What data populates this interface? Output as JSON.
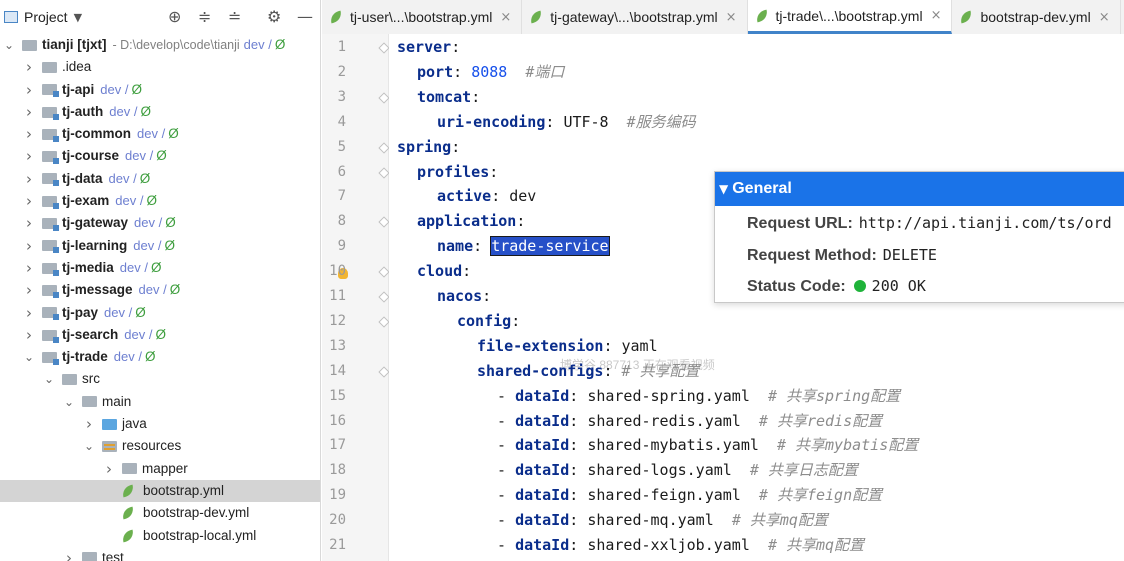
{
  "project": {
    "title": "Project",
    "root": {
      "name": "tianji [tjxt]",
      "path": "- D:\\develop\\code\\tianji",
      "vcs": "dev /",
      "status": "Ø"
    },
    "items": [
      {
        "label": ".idea",
        "type": "folder",
        "level": 1,
        "expanded": false
      },
      {
        "label": "tj-api",
        "vcs": "dev /",
        "status": "Ø",
        "type": "module",
        "level": 1,
        "expanded": false
      },
      {
        "label": "tj-auth",
        "vcs": "dev /",
        "status": "Ø",
        "type": "module",
        "level": 1,
        "expanded": false
      },
      {
        "label": "tj-common",
        "vcs": "dev /",
        "status": "Ø",
        "type": "module",
        "level": 1,
        "expanded": false
      },
      {
        "label": "tj-course",
        "vcs": "dev /",
        "status": "Ø",
        "type": "module",
        "level": 1,
        "expanded": false
      },
      {
        "label": "tj-data",
        "vcs": "dev /",
        "status": "Ø",
        "type": "module",
        "level": 1,
        "expanded": false
      },
      {
        "label": "tj-exam",
        "vcs": "dev /",
        "status": "Ø",
        "type": "module",
        "level": 1,
        "expanded": false
      },
      {
        "label": "tj-gateway",
        "vcs": "dev /",
        "status": "Ø",
        "type": "module",
        "level": 1,
        "expanded": false
      },
      {
        "label": "tj-learning",
        "vcs": "dev /",
        "status": "Ø",
        "type": "module",
        "level": 1,
        "expanded": false
      },
      {
        "label": "tj-media",
        "vcs": "dev /",
        "status": "Ø",
        "type": "module",
        "level": 1,
        "expanded": false
      },
      {
        "label": "tj-message",
        "vcs": "dev /",
        "status": "Ø",
        "type": "module",
        "level": 1,
        "expanded": false
      },
      {
        "label": "tj-pay",
        "vcs": "dev /",
        "status": "Ø",
        "type": "module",
        "level": 1,
        "expanded": false
      },
      {
        "label": "tj-search",
        "vcs": "dev /",
        "status": "Ø",
        "type": "module",
        "level": 1,
        "expanded": false
      },
      {
        "label": "tj-trade",
        "vcs": "dev /",
        "status": "Ø",
        "type": "module",
        "level": 1,
        "expanded": true
      },
      {
        "label": "src",
        "type": "folder",
        "level": 2,
        "expanded": true
      },
      {
        "label": "main",
        "type": "folder",
        "level": 3,
        "expanded": true
      },
      {
        "label": "java",
        "type": "java",
        "level": 4,
        "expanded": false
      },
      {
        "label": "resources",
        "type": "resources",
        "level": 4,
        "expanded": true
      },
      {
        "label": "mapper",
        "type": "folder",
        "level": 5,
        "expanded": false
      },
      {
        "label": "bootstrap.yml",
        "type": "file",
        "level": 5,
        "selected": true
      },
      {
        "label": "bootstrap-dev.yml",
        "type": "file",
        "level": 5
      },
      {
        "label": "bootstrap-local.yml",
        "type": "file",
        "level": 5
      },
      {
        "label": "test",
        "type": "folder",
        "level": 3,
        "expanded": false
      }
    ]
  },
  "tabs": [
    {
      "label": "tj-user\\...\\bootstrap.yml",
      "active": false,
      "closable": true
    },
    {
      "label": "tj-gateway\\...\\bootstrap.yml",
      "active": false,
      "closable": true
    },
    {
      "label": "tj-trade\\...\\bootstrap.yml",
      "active": true,
      "closable": true
    },
    {
      "label": "bootstrap-dev.yml",
      "active": false,
      "closable": true
    }
  ],
  "editor": {
    "lines": [
      {
        "n": "1",
        "indent": 0,
        "key": "server",
        "value": "",
        "comment": ""
      },
      {
        "n": "2",
        "indent": 1,
        "key": "port",
        "value": "8088",
        "valueType": "number",
        "comment": "#端口"
      },
      {
        "n": "3",
        "indent": 1,
        "key": "tomcat",
        "value": "",
        "comment": ""
      },
      {
        "n": "4",
        "indent": 2,
        "key": "uri-encoding",
        "value": "UTF-8",
        "comment": "#服务编码"
      },
      {
        "n": "5",
        "indent": 0,
        "key": "spring",
        "value": "",
        "comment": ""
      },
      {
        "n": "6",
        "indent": 1,
        "key": "profiles",
        "value": "",
        "comment": ""
      },
      {
        "n": "7",
        "indent": 2,
        "key": "active",
        "value": "dev",
        "comment": ""
      },
      {
        "n": "8",
        "indent": 1,
        "key": "application",
        "value": "",
        "comment": ""
      },
      {
        "n": "9",
        "indent": 2,
        "key": "name",
        "value": "trade-service",
        "selected": true,
        "comment": ""
      },
      {
        "n": "10",
        "indent": 1,
        "key": "cloud",
        "value": "",
        "comment": ""
      },
      {
        "n": "11",
        "indent": 2,
        "key": "nacos",
        "value": "",
        "comment": ""
      },
      {
        "n": "12",
        "indent": 3,
        "key": "config",
        "value": "",
        "comment": ""
      },
      {
        "n": "13",
        "indent": 4,
        "key": "file-extension",
        "value": "yaml",
        "comment": ""
      },
      {
        "n": "14",
        "indent": 4,
        "key": "shared-configs",
        "value": "",
        "comment": "# 共享配置"
      },
      {
        "n": "15",
        "indent": 5,
        "dash": true,
        "key": "dataId",
        "value": "shared-spring.yaml",
        "comment": "# 共享spring配置"
      },
      {
        "n": "16",
        "indent": 5,
        "dash": true,
        "key": "dataId",
        "value": "shared-redis.yaml",
        "comment": "# 共享redis配置"
      },
      {
        "n": "17",
        "indent": 5,
        "dash": true,
        "key": "dataId",
        "value": "shared-mybatis.yaml",
        "comment": "# 共享mybatis配置"
      },
      {
        "n": "18",
        "indent": 5,
        "dash": true,
        "key": "dataId",
        "value": "shared-logs.yaml",
        "comment": "# 共享日志配置"
      },
      {
        "n": "19",
        "indent": 5,
        "dash": true,
        "key": "dataId",
        "value": "shared-feign.yaml",
        "comment": "# 共享feign配置"
      },
      {
        "n": "20",
        "indent": 5,
        "dash": true,
        "key": "dataId",
        "value": "shared-mq.yaml",
        "comment": "# 共享mq配置"
      },
      {
        "n": "21",
        "indent": 5,
        "dash": true,
        "key": "dataId",
        "value": "shared-xxljob.yaml",
        "comment": "# 共享mq配置"
      }
    ],
    "watermark": "博学谷 887713 正在观看视频"
  },
  "popup": {
    "title": "General",
    "request_url_label": "Request URL:",
    "request_url": "http://api.tianji.com/ts/ord",
    "request_method_label": "Request Method:",
    "request_method": "DELETE",
    "status_code_label": "Status Code:",
    "status_code": "200 OK",
    "status_color": "#1fb33a",
    "header_color": "#1a73e8"
  }
}
